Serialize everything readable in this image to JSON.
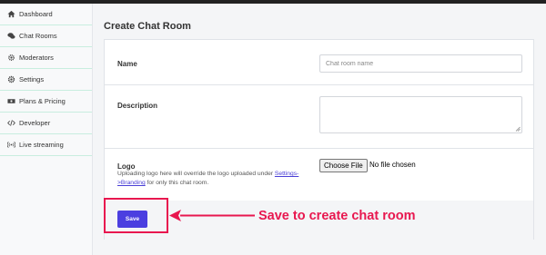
{
  "sidebar": {
    "items": [
      {
        "label": "Dashboard",
        "icon": "home-icon"
      },
      {
        "label": "Chat Rooms",
        "icon": "chat-icon"
      },
      {
        "label": "Moderators",
        "icon": "users-gear-icon"
      },
      {
        "label": "Settings",
        "icon": "gear-icon"
      },
      {
        "label": "Plans & Pricing",
        "icon": "money-icon"
      },
      {
        "label": "Developer",
        "icon": "code-icon"
      },
      {
        "label": "Live streaming",
        "icon": "broadcast-icon"
      }
    ]
  },
  "page": {
    "title": "Create Chat Room"
  },
  "form": {
    "name_label": "Name",
    "name_placeholder": "Chat room name",
    "description_label": "Description",
    "logo_label": "Logo",
    "choose_file_label": "Choose File",
    "file_status": "No file chosen",
    "logo_help_prefix": "Uploading logo here will override the logo uploaded under ",
    "logo_help_link": "Settings->Branding",
    "logo_help_suffix": " for only this chat room.",
    "save_label": "Save"
  },
  "annotation": {
    "callout_text": "Save to create chat room",
    "color": "#e8174f"
  },
  "colors": {
    "accent": "#4b3fe0",
    "sidebar_divider": "#c8eedf"
  }
}
